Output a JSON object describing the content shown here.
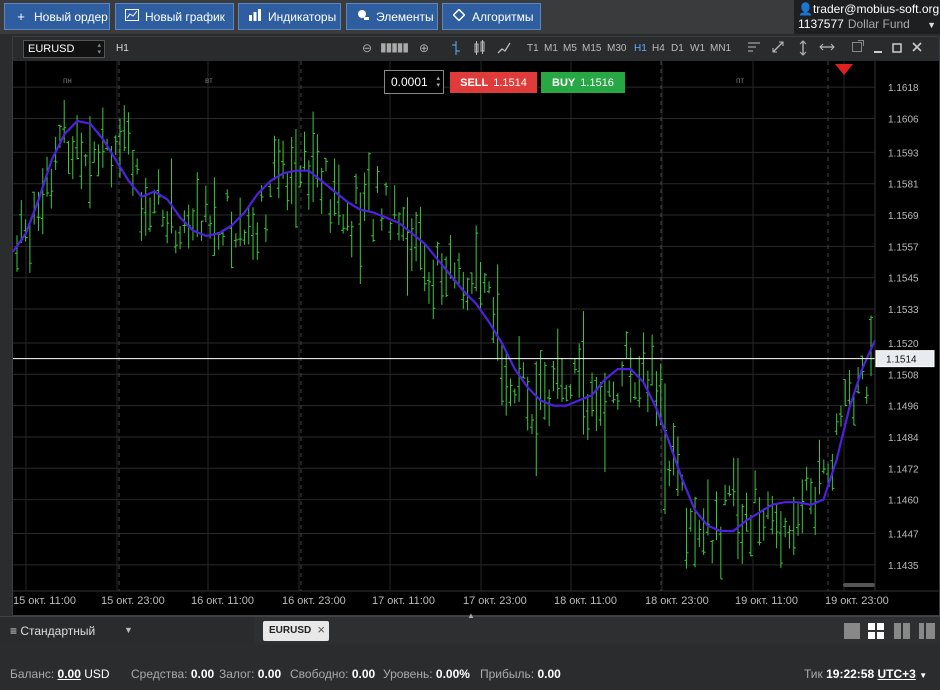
{
  "toolbar": {
    "new_order": "Новый ордер",
    "new_chart": "Новый график",
    "indicators": "Индикаторы",
    "elements": "Элементы",
    "algorithms": "Алгоритмы"
  },
  "account": {
    "email": "trader@mobius-soft.org",
    "number": "1137577",
    "fund": "Dollar Fund"
  },
  "chart": {
    "symbol": "EURUSD",
    "timeframe": "H1",
    "timeframes": [
      "T1",
      "M1",
      "M5",
      "M15",
      "M30",
      "H1",
      "H4",
      "D1",
      "W1",
      "MN1"
    ],
    "active_timeframe": "H1",
    "lot": "0.0001",
    "sell_label": "SELL",
    "sell_price": "1.1514",
    "buy_label": "BUY",
    "buy_price": "1.1516",
    "current_price_label": "1.1514",
    "day_labels": [
      "пн",
      "вт",
      "пт"
    ],
    "x_labels": [
      "15 окт. 11:00",
      "15 окт. 23:00",
      "16 окт. 11:00",
      "16 окт. 23:00",
      "17 окт. 11:00",
      "17 окт. 23:00",
      "18 окт. 11:00",
      "18 окт. 23:00",
      "19 окт. 11:00",
      "19 окт. 23:00"
    ],
    "y_labels": [
      "1.1618",
      "1.1606",
      "1.1593",
      "1.1581",
      "1.1569",
      "1.1557",
      "1.1545",
      "1.1533",
      "1.1520",
      "1.1508",
      "1.1496",
      "1.1484",
      "1.1472",
      "1.1460",
      "1.1447",
      "1.1435"
    ],
    "colors": {
      "bars": "#3cc83c",
      "ma": "#5020e0",
      "price_line": "#ffffff"
    }
  },
  "chart_data": {
    "type": "line",
    "symbol": "EURUSD",
    "timeframe": "H1",
    "ylim": [
      1.1425,
      1.1628
    ],
    "current_price": 1.1514,
    "ma_series": [
      1.1555,
      1.1562,
      1.1575,
      1.159,
      1.16,
      1.1605,
      1.1604,
      1.1598,
      1.159,
      1.1582,
      1.1576,
      1.1578,
      1.1575,
      1.1568,
      1.1563,
      1.1561,
      1.1562,
      1.1565,
      1.157,
      1.1577,
      1.1582,
      1.1585,
      1.1586,
      1.1586,
      1.1582,
      1.1578,
      1.1574,
      1.1571,
      1.157,
      1.1568,
      1.1566,
      1.1562,
      1.1558,
      1.1552,
      1.1546,
      1.154,
      1.1535,
      1.1528,
      1.152,
      1.151,
      1.1503,
      1.1498,
      1.1496,
      1.1496,
      1.1498,
      1.15,
      1.1506,
      1.151,
      1.151,
      1.1505,
      1.1495,
      1.1482,
      1.1468,
      1.1456,
      1.145,
      1.1448,
      1.1448,
      1.1452,
      1.1455,
      1.1458,
      1.1459,
      1.1459,
      1.1458,
      1.146,
      1.1475,
      1.1495,
      1.151,
      1.1521
    ]
  },
  "tabs": {
    "layout_name": "Стандартный",
    "chart_tab": "EURUSD"
  },
  "status": {
    "balance_label": "Баланс:",
    "balance_value": "0.00",
    "balance_currency": "USD",
    "equity_label": "Средства:",
    "equity_value": "0.00",
    "margin_label": "Залог:",
    "margin_value": "0.00",
    "free_label": "Свободно:",
    "free_value": "0.00",
    "level_label": "Уровень:",
    "level_value": "0.00%",
    "profit_label": "Прибыль:",
    "profit_value": "0.00",
    "tick_label": "Тик",
    "tick_time": "19:22:58",
    "timezone": "UTC+3"
  }
}
